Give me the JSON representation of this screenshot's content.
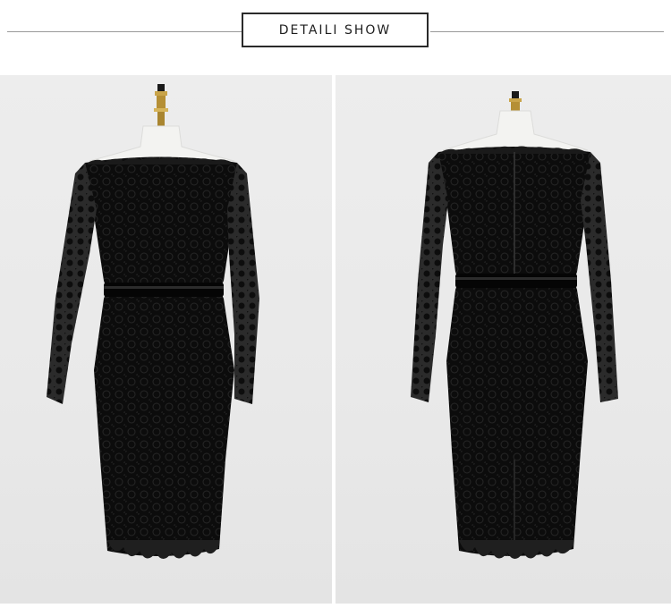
{
  "header": {
    "title": "DETAILI SHOW"
  },
  "photos": [
    {
      "view": "front",
      "subject": "dress-front-photo"
    },
    {
      "view": "back",
      "subject": "dress-back-photo"
    }
  ],
  "colors": {
    "background": "#ffffff",
    "photo_backdrop": "#ebebeb",
    "dress": "#0d0d0d",
    "lace_highlight": "#2a2a2a",
    "mannequin": "#f4f4f2",
    "finial_gold": "#c9a44a"
  }
}
